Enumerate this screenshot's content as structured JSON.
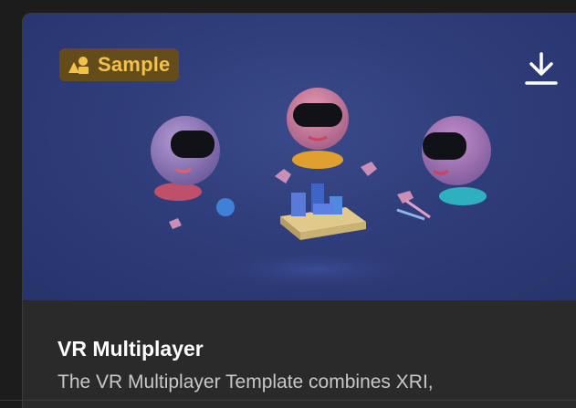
{
  "card": {
    "badge": {
      "icon": "shapes-icon",
      "label": "Sample"
    },
    "download": {
      "icon": "download-icon"
    },
    "title": "VR Multiplayer",
    "description": "The VR Multiplayer Template combines XRI,"
  },
  "colors": {
    "background": "#1c1c1c",
    "card": "#2a2a2a",
    "thumbnail": "#2f3d7a",
    "badge_bg": "#6e500a",
    "badge_text": "#f3c24a",
    "title": "#ffffff",
    "description": "#c8c8c8"
  }
}
